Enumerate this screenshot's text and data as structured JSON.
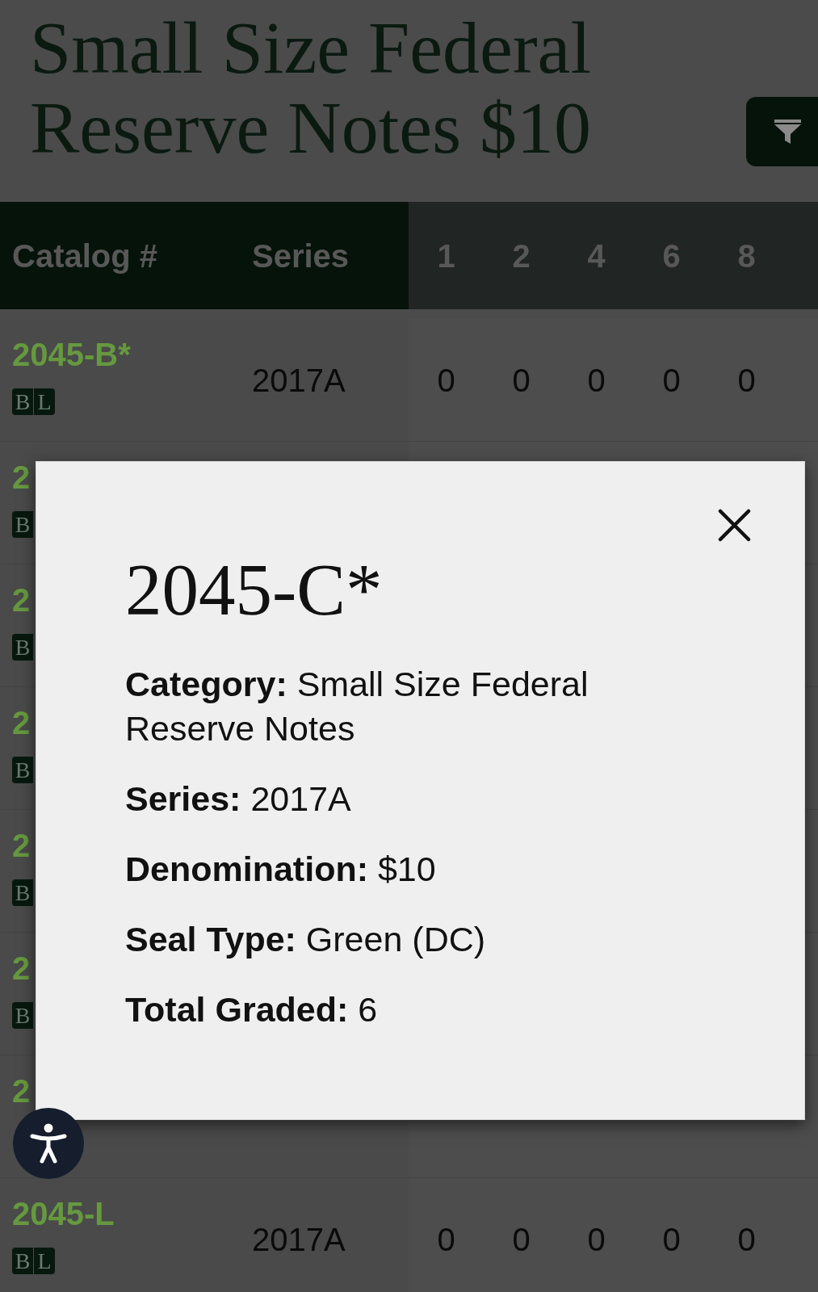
{
  "page": {
    "title": "Small Size Federal Reserve Notes $10"
  },
  "table": {
    "columns": [
      "Catalog #",
      "Series",
      "1",
      "2",
      "4",
      "6",
      "8"
    ],
    "rows": [
      {
        "catalog": "2045-B*",
        "badge": [
          "B",
          "L"
        ],
        "series": "2017A",
        "counts": [
          "0",
          "0",
          "0",
          "0",
          "0"
        ]
      },
      {
        "catalog": "2",
        "badge": [
          "B"
        ]
      },
      {
        "catalog": "2",
        "badge": [
          "B"
        ]
      },
      {
        "catalog": "2",
        "badge": [
          "B"
        ]
      },
      {
        "catalog": "2",
        "badge": [
          "B"
        ]
      },
      {
        "catalog": "2",
        "badge": [
          "B"
        ]
      },
      {
        "catalog": "2"
      },
      {
        "catalog": "2045-L",
        "badge": [
          "B",
          "L"
        ],
        "series": "2017A",
        "counts": [
          "0",
          "0",
          "0",
          "0",
          "0"
        ]
      }
    ]
  },
  "modal": {
    "title": "2045-C*",
    "details": [
      "**Category:** Small Size Federal Reserve Notes",
      "**Series:** 2017A",
      "**Denomination:** $10",
      "**Seal Type:** Green (DC)",
      "**Total Graded:** 6"
    ]
  }
}
